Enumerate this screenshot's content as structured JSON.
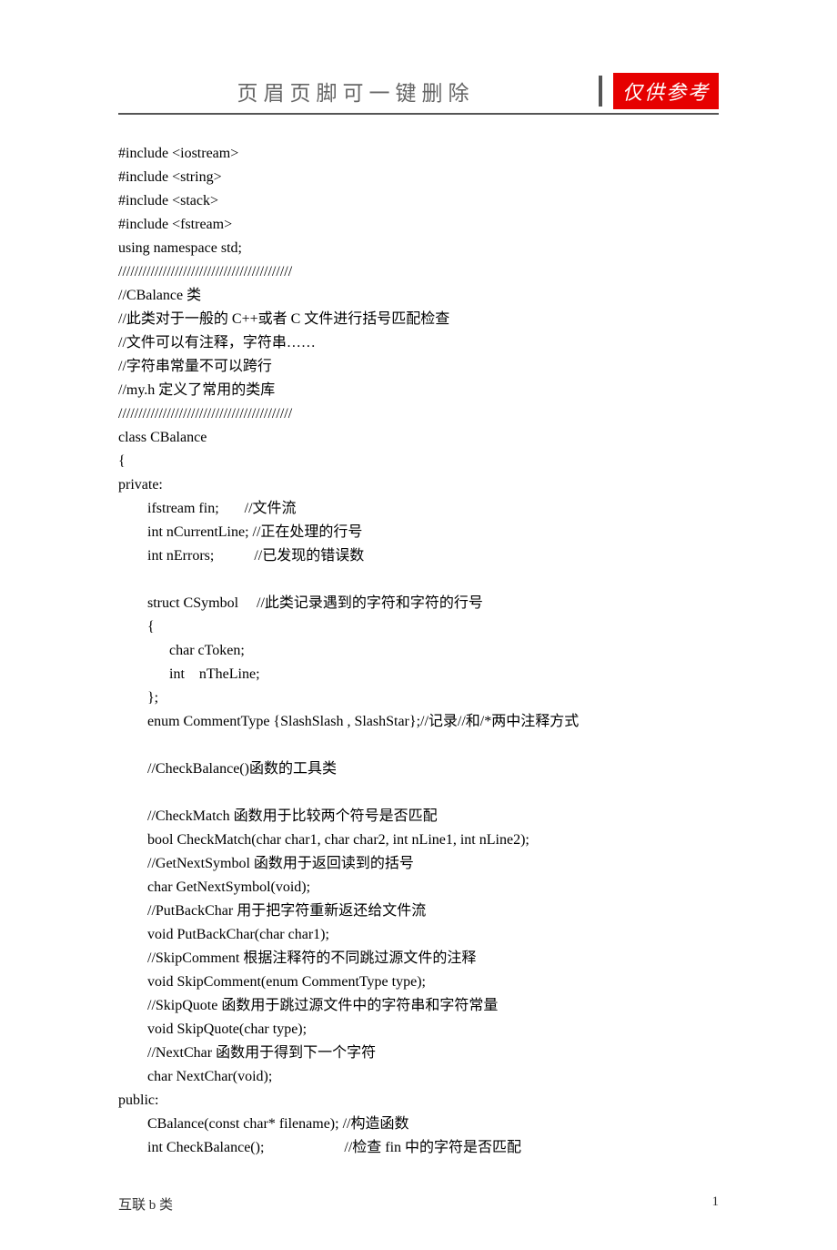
{
  "header": {
    "title": "页眉页脚可一键删除",
    "badge": "仅供参考"
  },
  "code_lines": [
    "#include <iostream>",
    "#include <string>",
    "#include <stack>",
    "#include <fstream>",
    "using namespace std;",
    "///////////////////////////////////////////",
    "//CBalance 类",
    "//此类对于一般的 C++或者 C 文件进行括号匹配检查",
    "//文件可以有注释，字符串……",
    "//字符串常量不可以跨行",
    "//my.h 定义了常用的类库",
    "///////////////////////////////////////////",
    "class CBalance",
    "{",
    "private:",
    "        ifstream fin;       //文件流",
    "        int nCurrentLine; //正在处理的行号",
    "        int nErrors;           //已发现的错误数",
    "",
    "        struct CSymbol     //此类记录遇到的字符和字符的行号",
    "        {",
    "              char cToken;",
    "              int    nTheLine;",
    "        };",
    "        enum CommentType {SlashSlash , SlashStar};//记录//和/*两中注释方式",
    "",
    "        //CheckBalance()函数的工具类",
    "",
    "        //CheckMatch 函数用于比较两个符号是否匹配",
    "        bool CheckMatch(char char1, char char2, int nLine1, int nLine2);",
    "        //GetNextSymbol 函数用于返回读到的括号",
    "        char GetNextSymbol(void);",
    "        //PutBackChar 用于把字符重新返还给文件流",
    "        void PutBackChar(char char1);",
    "        //SkipComment 根据注释符的不同跳过源文件的注释",
    "        void SkipComment(enum CommentType type);",
    "        //SkipQuote 函数用于跳过源文件中的字符串和字符常量",
    "        void SkipQuote(char type);",
    "        //NextChar 函数用于得到下一个字符",
    "        char NextChar(void);",
    "public:",
    "        CBalance(const char* filename); //构造函数",
    "        int CheckBalance();                      //检查 fin 中的字符是否匹配"
  ],
  "footer": {
    "left": "互联 b 类",
    "right": "1"
  }
}
